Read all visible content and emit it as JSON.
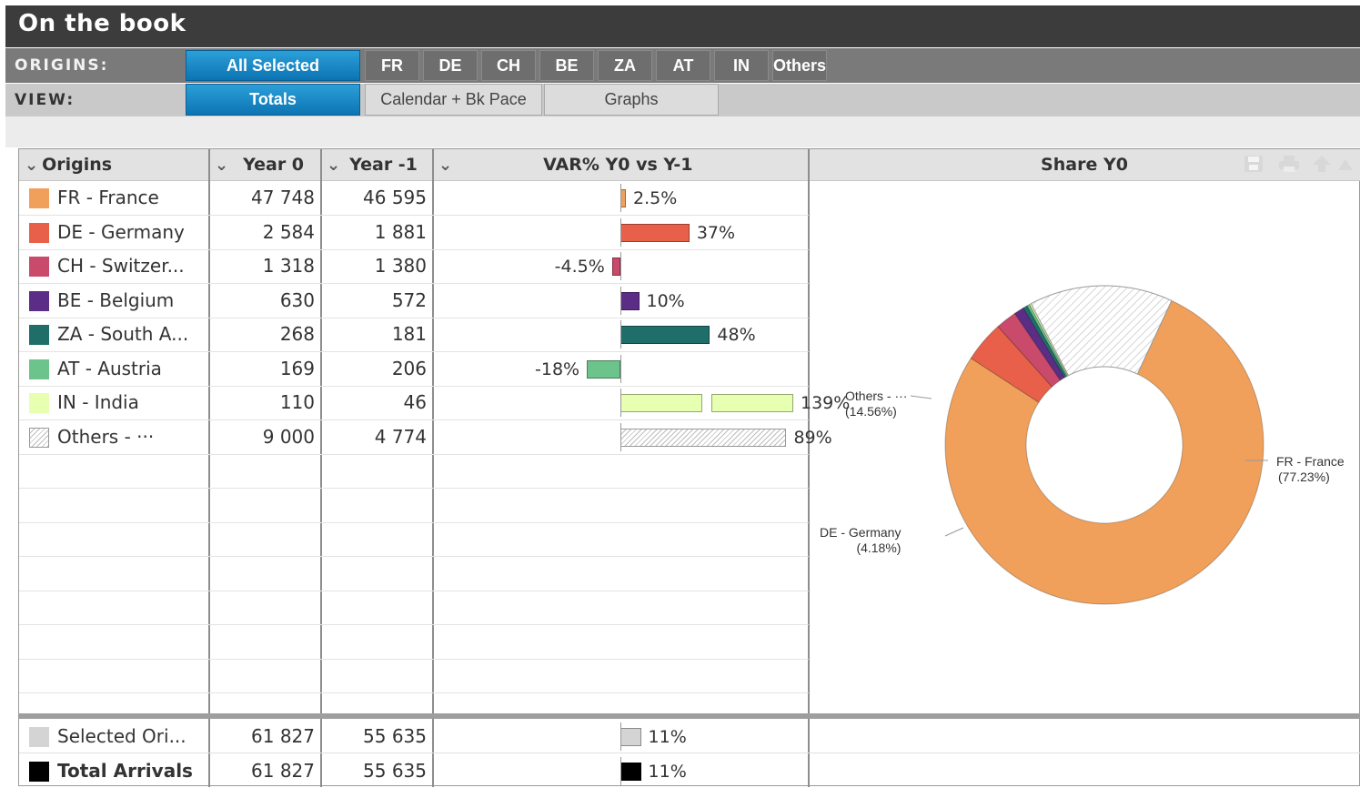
{
  "title": "On the book",
  "origins_row": {
    "label": "ORIGINS:",
    "buttons": [
      "All Selected",
      "FR",
      "DE",
      "CH",
      "BE",
      "ZA",
      "AT",
      "IN",
      "Others"
    ],
    "selected": "All Selected"
  },
  "view_row": {
    "label": "VIEW:",
    "buttons": [
      "Totals",
      "Calendar + Bk Pace",
      "Graphs"
    ],
    "selected": "Totals"
  },
  "table": {
    "headers": [
      "Origins",
      "Year 0",
      "Year -1",
      "VAR% Y0 vs Y-1",
      "Share Y0"
    ],
    "rows": [
      {
        "origin": "FR - France",
        "year0": "47 748",
        "year1": "46 595",
        "var_label": "2.5%",
        "var": 2.5,
        "color": "#f0a05a"
      },
      {
        "origin": "DE - Germany",
        "year0": "2 584",
        "year1": "1 881",
        "var_label": "37%",
        "var": 37,
        "color": "#e8604a"
      },
      {
        "origin": "CH - Switzer...",
        "year0": "1 318",
        "year1": "1 380",
        "var_label": "-4.5%",
        "var": -4.5,
        "color": "#c94a6a"
      },
      {
        "origin": "BE - Belgium",
        "year0": "630",
        "year1": "572",
        "var_label": "10%",
        "var": 10,
        "color": "#5b2d86"
      },
      {
        "origin": "ZA - South A...",
        "year0": "268",
        "year1": "181",
        "var_label": "48%",
        "var": 48,
        "color": "#1f6e6a"
      },
      {
        "origin": "AT - Austria",
        "year0": "169",
        "year1": "206",
        "var_label": "-18%",
        "var": -18,
        "color": "#6cc38b"
      },
      {
        "origin": "IN - India",
        "year0": "110",
        "year1": "46",
        "var_label": "139%",
        "var": 139,
        "color": "#e6ffb0"
      },
      {
        "origin": "Others - ···",
        "year0": "9 000",
        "year1": "4 774",
        "var_label": "89%",
        "var": 89,
        "color": "hatch"
      }
    ],
    "totals": [
      {
        "origin": "Selected Ori...",
        "year0": "61 827",
        "year1": "55 635",
        "var_label": "11%",
        "var": 11,
        "color": "#d4d4d4",
        "bold": false
      },
      {
        "origin": "Total Arrivals",
        "year0": "61 827",
        "year1": "55 635",
        "var_label": "11%",
        "var": 11,
        "color": "#000000",
        "bold": true
      }
    ]
  },
  "chart_data": {
    "type": "pie",
    "title": "Share Y0",
    "slices": [
      {
        "name": "FR - France",
        "value": 77.23,
        "label": "FR - France",
        "pct_label": "(77.23%)",
        "color": "#f0a05a"
      },
      {
        "name": "DE - Germany",
        "value": 4.18,
        "label": "DE - Germany",
        "pct_label": "(4.18%)",
        "color": "#e8604a"
      },
      {
        "name": "CH - Switzerland",
        "value": 2.13,
        "color": "#c94a6a"
      },
      {
        "name": "BE - Belgium",
        "value": 1.02,
        "color": "#5b2d86"
      },
      {
        "name": "ZA - South Africa",
        "value": 0.43,
        "color": "#1f6e6a"
      },
      {
        "name": "AT - Austria",
        "value": 0.27,
        "color": "#6cc38b"
      },
      {
        "name": "IN - India",
        "value": 0.18,
        "color": "#e6ffb0"
      },
      {
        "name": "Others",
        "value": 14.56,
        "label": "Others - ···",
        "pct_label": "(14.56%)",
        "color": "hatch"
      }
    ]
  },
  "toolbar_icons": [
    "save-icon",
    "print-icon",
    "export-icon"
  ]
}
